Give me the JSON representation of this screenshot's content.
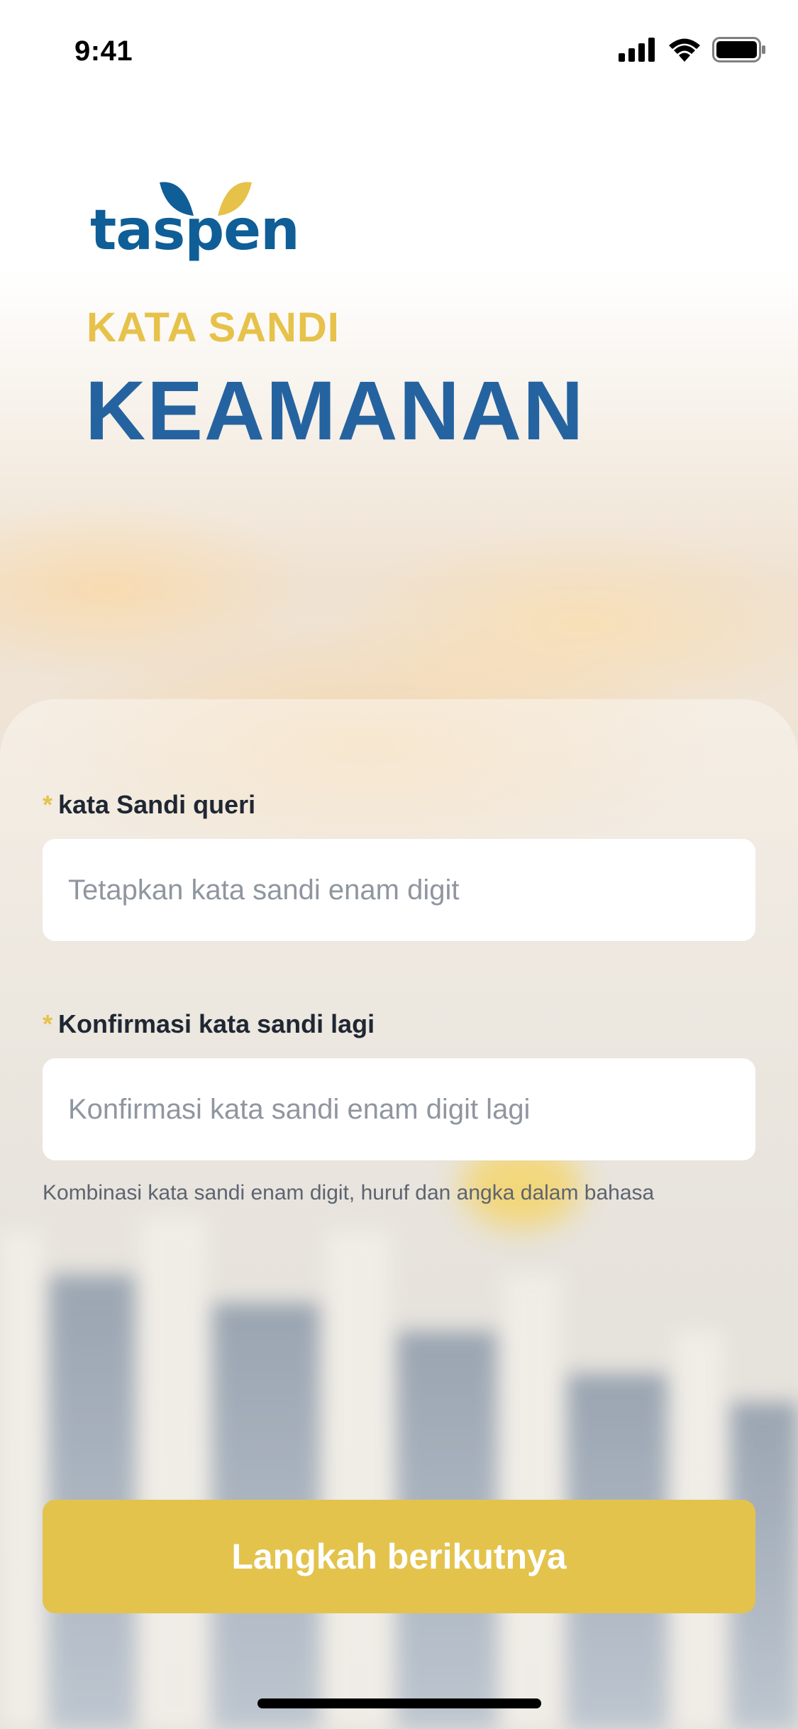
{
  "status_bar": {
    "time": "9:41"
  },
  "logo": {
    "text": "taspen"
  },
  "header": {
    "subtitle": "KATA SANDI",
    "title": "KEAMANAN"
  },
  "form": {
    "password": {
      "required_mark": "*",
      "label": "kata Sandi queri",
      "placeholder": "Tetapkan kata sandi enam digit"
    },
    "confirm": {
      "required_mark": "*",
      "label": "Konfirmasi kata sandi lagi",
      "placeholder": "Konfirmasi kata sandi enam digit lagi"
    },
    "hint": "Kombinasi kata sandi enam digit, huruf dan angka dalam bahasa"
  },
  "actions": {
    "next_label": "Langkah berikutnya"
  },
  "colors": {
    "accent_yellow": "#e3c34c",
    "brand_blue": "#2563a0",
    "logo_blue": "#0f5e97"
  }
}
